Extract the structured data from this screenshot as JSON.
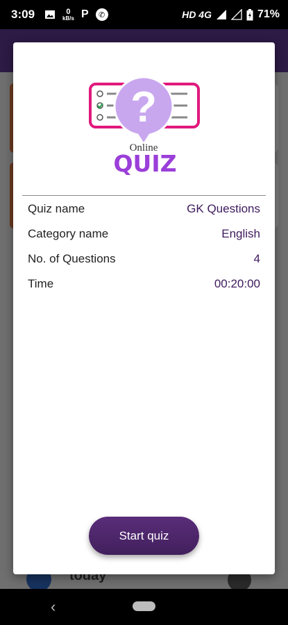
{
  "status_bar": {
    "time": "3:09",
    "data_rate_value": "0",
    "data_rate_unit": "kB/s",
    "p_icon_label": "P",
    "network": "HD 4G",
    "battery": "71%",
    "icons": [
      "image-icon",
      "parking-icon",
      "phone-icon",
      "signal-icon",
      "battery-icon"
    ]
  },
  "background": {
    "partial_text": "today"
  },
  "dialog": {
    "logo": {
      "question_mark": "?",
      "online_text": "Online",
      "quiz_text": "QUIZ"
    },
    "rows": [
      {
        "label": "Quiz name",
        "value": "GK Questions"
      },
      {
        "label": "Category name",
        "value": "English"
      },
      {
        "label": "No. of Questions",
        "value": "4"
      },
      {
        "label": "Time",
        "value": "00:20:00"
      }
    ],
    "start_button_label": "Start quiz"
  },
  "nav_bar": {
    "back_glyph": "‹"
  },
  "colors": {
    "accent": "#41205c",
    "logo_pink": "#e0197d",
    "logo_purple": "#9b3fd9",
    "bubble": "#c9a7ef"
  }
}
